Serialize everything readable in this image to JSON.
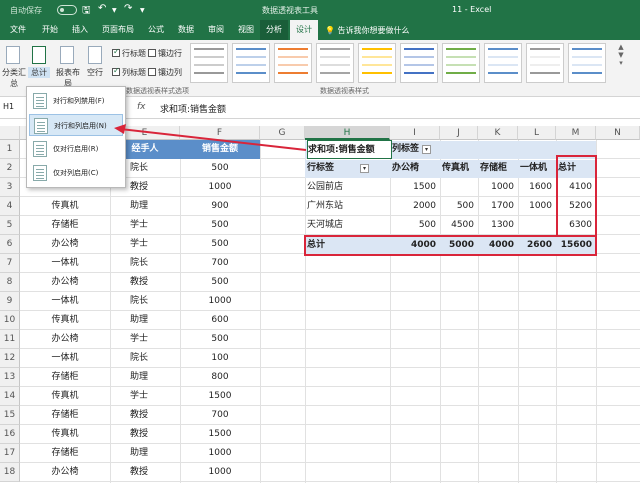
{
  "title_bar": {
    "autosave": "自动保存",
    "toggle_state": "关",
    "context_title": "数据透视表工具",
    "document_title": "11  -  Excel"
  },
  "tabs": [
    {
      "label": "文件"
    },
    {
      "label": "开始"
    },
    {
      "label": "插入"
    },
    {
      "label": "页面布局"
    },
    {
      "label": "公式"
    },
    {
      "label": "数据"
    },
    {
      "label": "审阅"
    },
    {
      "label": "视图"
    },
    {
      "label": "分析"
    },
    {
      "label": "设计"
    }
  ],
  "tell_me": "告诉我你想要做什么",
  "ribbon": {
    "subtotal_label": "分类汇总",
    "grandtotal_label": "总计",
    "report_layout_label": "报表布局",
    "blank_rows_label": "空行",
    "options": {
      "row_headers": "行标题",
      "banded_rows": "镶边行",
      "col_headers": "列标题",
      "banded_cols": "镶边列"
    },
    "options_group_label": "数据透视表样式选项",
    "styles_group_label": "数据透视表样式"
  },
  "formula_bar": {
    "name_box": "H1",
    "fx": "fx",
    "formula": "求和项:销售金额"
  },
  "columns": [
    "E",
    "F",
    "G",
    "H",
    "I",
    "J",
    "K",
    "L",
    "M",
    "N"
  ],
  "rows": [
    "1",
    "2",
    "3",
    "4",
    "5",
    "6",
    "7",
    "8",
    "9",
    "10",
    "11",
    "12",
    "13",
    "14",
    "15",
    "16",
    "17",
    "18"
  ],
  "source_table": {
    "headers": [
      "经手人",
      "销售金额"
    ],
    "rows": [
      {
        "a": "",
        "b": "院长",
        "c": "500"
      },
      {
        "a": "",
        "b": "教授",
        "c": "1000"
      },
      {
        "a": "传真机",
        "b": "助理",
        "c": "900"
      },
      {
        "a": "存储柜",
        "b": "学士",
        "c": "500"
      },
      {
        "a": "办公椅",
        "b": "学士",
        "c": "500"
      },
      {
        "a": "一体机",
        "b": "院长",
        "c": "700"
      },
      {
        "a": "办公椅",
        "b": "教授",
        "c": "500"
      },
      {
        "a": "一体机",
        "b": "院长",
        "c": "1000"
      },
      {
        "a": "传真机",
        "b": "助理",
        "c": "600"
      },
      {
        "a": "办公椅",
        "b": "学士",
        "c": "500"
      },
      {
        "a": "一体机",
        "b": "院长",
        "c": "100"
      },
      {
        "a": "存储柜",
        "b": "助理",
        "c": "800"
      },
      {
        "a": "传真机",
        "b": "学士",
        "c": "1500"
      },
      {
        "a": "存储柜",
        "b": "教授",
        "c": "700"
      },
      {
        "a": "传真机",
        "b": "教授",
        "c": "1500"
      },
      {
        "a": "存储柜",
        "b": "助理",
        "c": "1000"
      },
      {
        "a": "办公椅",
        "b": "教授",
        "c": "1000"
      }
    ]
  },
  "pivot": {
    "value_label": "求和项:销售金额",
    "col_label": "列标签",
    "row_label": "行标签",
    "col_headers": [
      "办公椅",
      "传真机",
      "存储柜",
      "一体机",
      "总计"
    ],
    "rows": [
      {
        "label": "公园前店",
        "values": [
          "1500",
          "",
          "1000",
          "1600",
          "4100"
        ]
      },
      {
        "label": "广州东站",
        "values": [
          "2000",
          "500",
          "1700",
          "1000",
          "5200"
        ]
      },
      {
        "label": "天河城店",
        "values": [
          "500",
          "4500",
          "1300",
          "",
          "6300"
        ]
      }
    ],
    "total": {
      "label": "总计",
      "values": [
        "4000",
        "5000",
        "4000",
        "2600",
        "15600"
      ]
    }
  },
  "grandtotal_menu": [
    {
      "label": "对行和列禁用(F)"
    },
    {
      "label": "对行和列启用(N)"
    },
    {
      "label": "仅对行启用(R)"
    },
    {
      "label": "仅对列启用(C)"
    }
  ],
  "colors": {
    "excel_green": "#217346",
    "header_blue": "#5b8ec9",
    "pivot_blue": "#dbe6f4",
    "highlight_red": "#d9253a"
  }
}
